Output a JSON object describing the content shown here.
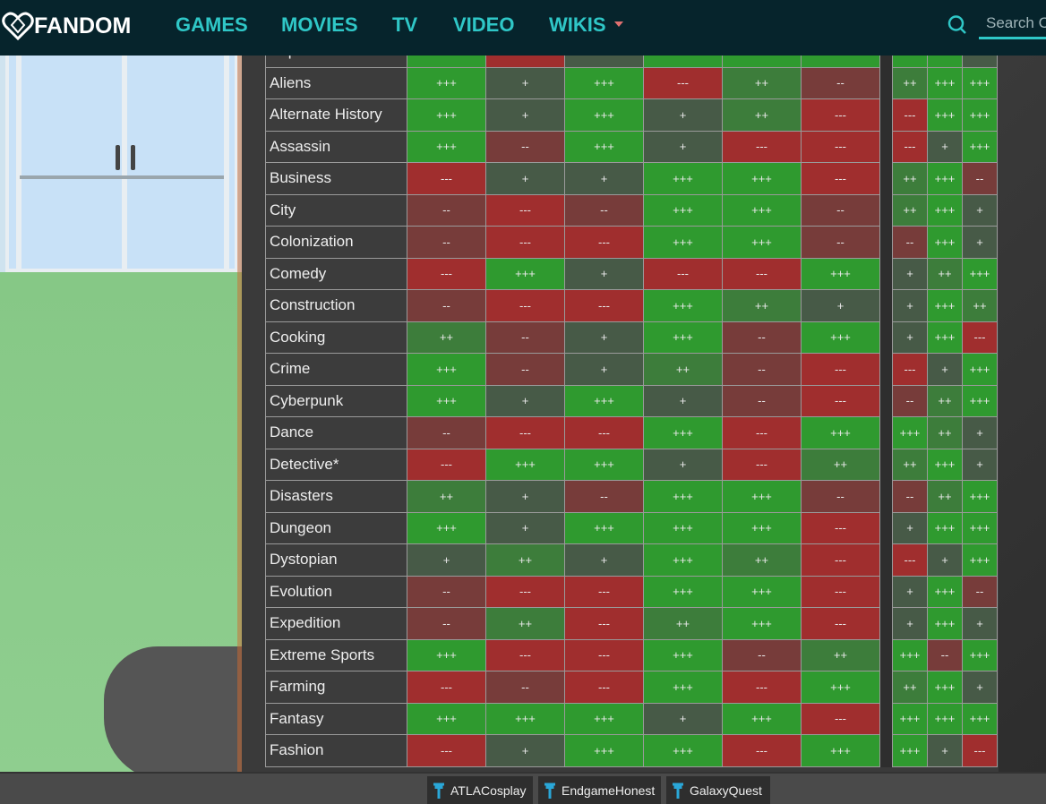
{
  "header": {
    "logo": "FANDOM",
    "nav": [
      "GAMES",
      "MOVIES",
      "TV",
      "VIDEO",
      "WIKIS"
    ],
    "search_placeholder": "Search C"
  },
  "colors": {
    "+++": "#2f9a2f",
    "++": "#3d7d3b",
    "+": "#475a47",
    "--": "#773c3a",
    "---": "#a02e2e",
    "brand": "#2fc7c7"
  },
  "table": {
    "rows": [
      {
        "label": "Airplane",
        "cells": [
          "+++",
          "---",
          "+",
          "+++",
          "+++",
          "+++",
          "+++",
          "+++",
          "+"
        ]
      },
      {
        "label": "Aliens",
        "cells": [
          "+++",
          "+",
          "+++",
          "---",
          "++",
          "--",
          "++",
          "+++",
          "+++"
        ]
      },
      {
        "label": "Alternate History",
        "cells": [
          "+++",
          "+",
          "+++",
          "+",
          "++",
          "---",
          "---",
          "+++",
          "+++"
        ]
      },
      {
        "label": "Assassin",
        "cells": [
          "+++",
          "--",
          "+++",
          "+",
          "---",
          "---",
          "---",
          "+",
          "+++"
        ]
      },
      {
        "label": "Business",
        "cells": [
          "---",
          "+",
          "+",
          "+++",
          "+++",
          "---",
          "++",
          "+++",
          "--"
        ]
      },
      {
        "label": "City",
        "cells": [
          "--",
          "---",
          "--",
          "+++",
          "+++",
          "--",
          "++",
          "+++",
          "+"
        ]
      },
      {
        "label": "Colonization",
        "cells": [
          "--",
          "---",
          "---",
          "+++",
          "+++",
          "--",
          "--",
          "+++",
          "+"
        ]
      },
      {
        "label": "Comedy",
        "cells": [
          "---",
          "+++",
          "+",
          "---",
          "---",
          "+++",
          "+",
          "++",
          "+++"
        ]
      },
      {
        "label": "Construction",
        "cells": [
          "--",
          "---",
          "---",
          "+++",
          "++",
          "+",
          "+",
          "+++",
          "++"
        ]
      },
      {
        "label": "Cooking",
        "cells": [
          "++",
          "--",
          "+",
          "+++",
          "--",
          "+++",
          "+",
          "+++",
          "---"
        ]
      },
      {
        "label": "Crime",
        "cells": [
          "+++",
          "--",
          "+",
          "++",
          "--",
          "---",
          "---",
          "+",
          "+++"
        ]
      },
      {
        "label": "Cyberpunk",
        "cells": [
          "+++",
          "+",
          "+++",
          "+",
          "--",
          "---",
          "--",
          "++",
          "+++"
        ]
      },
      {
        "label": "Dance",
        "cells": [
          "--",
          "---",
          "---",
          "+++",
          "---",
          "+++",
          "+++",
          "++",
          "+"
        ]
      },
      {
        "label": "Detective*",
        "cells": [
          "---",
          "+++",
          "+++",
          "+",
          "---",
          "++",
          "++",
          "+++",
          "+"
        ]
      },
      {
        "label": "Disasters",
        "cells": [
          "++",
          "+",
          "--",
          "+++",
          "+++",
          "--",
          "--",
          "++",
          "+++"
        ]
      },
      {
        "label": "Dungeon",
        "cells": [
          "+++",
          "+",
          "+++",
          "+++",
          "+++",
          "---",
          "+",
          "+++",
          "+++"
        ]
      },
      {
        "label": "Dystopian",
        "cells": [
          "+",
          "++",
          "+",
          "+++",
          "++",
          "---",
          "---",
          "+",
          "+++"
        ]
      },
      {
        "label": "Evolution",
        "cells": [
          "--",
          "---",
          "---",
          "+++",
          "+++",
          "---",
          "+",
          "+++",
          "--"
        ]
      },
      {
        "label": "Expedition",
        "cells": [
          "--",
          "++",
          "---",
          "++",
          "+++",
          "---",
          "+",
          "+++",
          "+"
        ]
      },
      {
        "label": "Extreme Sports",
        "cells": [
          "+++",
          "---",
          "---",
          "+++",
          "--",
          "++",
          "+++",
          "--",
          "+++"
        ]
      },
      {
        "label": "Farming",
        "cells": [
          "---",
          "--",
          "---",
          "+++",
          "---",
          "+++",
          "++",
          "+++",
          "+"
        ]
      },
      {
        "label": "Fantasy",
        "cells": [
          "+++",
          "+++",
          "+++",
          "+",
          "+++",
          "---",
          "+++",
          "+++",
          "+++"
        ]
      },
      {
        "label": "Fashion",
        "cells": [
          "---",
          "+",
          "+++",
          "+++",
          "---",
          "+++",
          "+++",
          "+",
          "---"
        ]
      }
    ]
  },
  "taskbar": {
    "tabs": [
      "ATLACosplay",
      "EndgameHonest",
      "GalaxyQuest"
    ]
  }
}
